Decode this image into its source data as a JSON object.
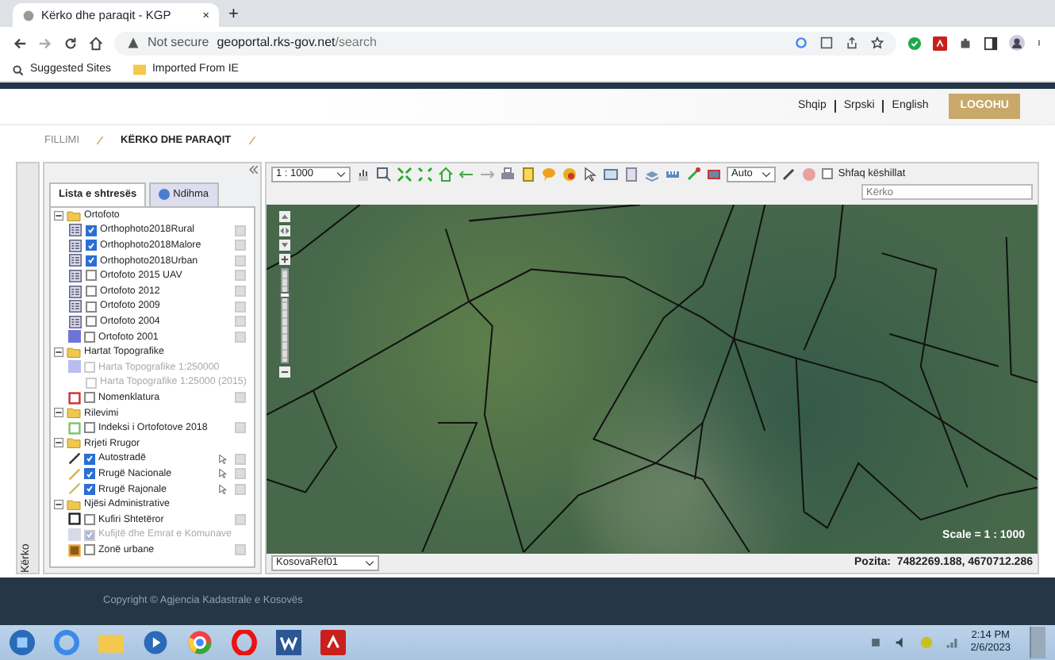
{
  "browser": {
    "tab_title": "Kërko dhe paraqit - KGP",
    "tab_close": "×",
    "new_tab": "+",
    "security": "Not secure",
    "url_host": "geoportal.rks-gov.net",
    "url_path": "/search",
    "bookmarks": [
      "Suggested Sites",
      "Imported From IE"
    ]
  },
  "header": {
    "languages": [
      "Shqip",
      "Srpski",
      "English"
    ],
    "login": "LOGOHU"
  },
  "breadcrumb": [
    {
      "label": "FILLIMI",
      "selected": false
    },
    {
      "label": "KËRKO DHE PARAQIT",
      "selected": true
    }
  ],
  "side_tab": "Kërko",
  "panel": {
    "tabs": [
      {
        "label": "Lista e shtresës",
        "selected": true
      },
      {
        "label": "Ndihma",
        "selected": false
      }
    ],
    "layers": [
      {
        "label": "Ortofoto",
        "expanded": true,
        "children": [
          {
            "label": "Orthophoto2018Rural",
            "kind": "raster",
            "checked": true,
            "disabled": false,
            "options": true,
            "selectable": false
          },
          {
            "label": "Orthophoto2018Malore",
            "kind": "raster",
            "checked": true,
            "disabled": false,
            "options": true,
            "selectable": false
          },
          {
            "label": "Orthophoto2018Urban",
            "kind": "raster",
            "checked": true,
            "disabled": false,
            "options": true,
            "selectable": false
          },
          {
            "label": "Ortofoto 2015 UAV",
            "kind": "raster",
            "checked": false,
            "disabled": false,
            "options": true,
            "selectable": false
          },
          {
            "label": "Ortofoto 2012",
            "kind": "raster",
            "checked": false,
            "disabled": false,
            "options": true,
            "selectable": false
          },
          {
            "label": "Ortofoto 2009",
            "kind": "raster",
            "checked": false,
            "disabled": false,
            "options": true,
            "selectable": false
          },
          {
            "label": "Ortofoto 2004",
            "kind": "raster",
            "checked": false,
            "disabled": false,
            "options": true,
            "selectable": false
          },
          {
            "label": "Ortofoto 2001",
            "kind": "fill",
            "color": "#6f75d8",
            "checked": false,
            "disabled": false,
            "options": true,
            "selectable": false
          }
        ]
      },
      {
        "label": "Hartat Topografike",
        "expanded": true,
        "children": [
          {
            "label": "Harta Topografike 1:250000",
            "kind": "fill",
            "color": "#b9bdf0",
            "checked": false,
            "disabled": true,
            "options": false,
            "selectable": false
          },
          {
            "label": "Harta Topografike 1:25000 (2015)",
            "kind": "none",
            "checked": false,
            "disabled": true,
            "options": false,
            "selectable": false
          },
          {
            "label": "Nomenklatura",
            "kind": "outline",
            "color": "#d03030",
            "checked": false,
            "disabled": false,
            "options": true,
            "selectable": false
          }
        ]
      },
      {
        "label": "Rilevimi",
        "expanded": true,
        "children": [
          {
            "label": "Indeksi i Ortofotove 2018",
            "kind": "outline",
            "color": "#7cc46a",
            "checked": false,
            "disabled": false,
            "options": true,
            "selectable": false
          }
        ]
      },
      {
        "label": "Rrjeti Rrugor",
        "expanded": true,
        "children": [
          {
            "label": "Autostradë",
            "kind": "line",
            "color": "#333333",
            "checked": true,
            "disabled": false,
            "options": true,
            "selectable": true
          },
          {
            "label": "Rrugë Nacionale",
            "kind": "line",
            "color": "#e0b040",
            "checked": true,
            "disabled": false,
            "options": true,
            "selectable": true
          },
          {
            "label": "Rrugë Rajonale",
            "kind": "line",
            "color": "#c8c070",
            "checked": true,
            "disabled": false,
            "options": true,
            "selectable": true
          }
        ]
      },
      {
        "label": "Njësi Administrative",
        "expanded": true,
        "children": [
          {
            "label": "Kufiri Shtetëror",
            "kind": "outline",
            "color": "#222222",
            "checked": false,
            "disabled": false,
            "options": true,
            "selectable": false
          },
          {
            "label": "Kufijtë dhe Emrat e Komunave",
            "kind": "fill",
            "color": "#d8dae8",
            "checked": true,
            "disabled": true,
            "options": false,
            "selectable": false
          },
          {
            "label": "Zonë urbane",
            "kind": "zone",
            "color": "#8a5a20",
            "checked": false,
            "disabled": false,
            "options": true,
            "selectable": false
          }
        ]
      }
    ]
  },
  "toolbar": {
    "scale": "1 : 1000",
    "units": "Auto",
    "tips": {
      "label": "Shfaq këshillat",
      "checked": false
    },
    "search": {
      "placeholder": "Kërko"
    }
  },
  "map": {
    "scale_label": "Scale = 1 : 1000",
    "projection": "KosovaRef01",
    "position": "Pozita:  7482269.188, 4670712.286"
  },
  "footer": "Copyright © Agjencia Kadastrale e Kosovës",
  "taskbar": {
    "time": "2:14 PM",
    "date": "2/6/2023"
  }
}
